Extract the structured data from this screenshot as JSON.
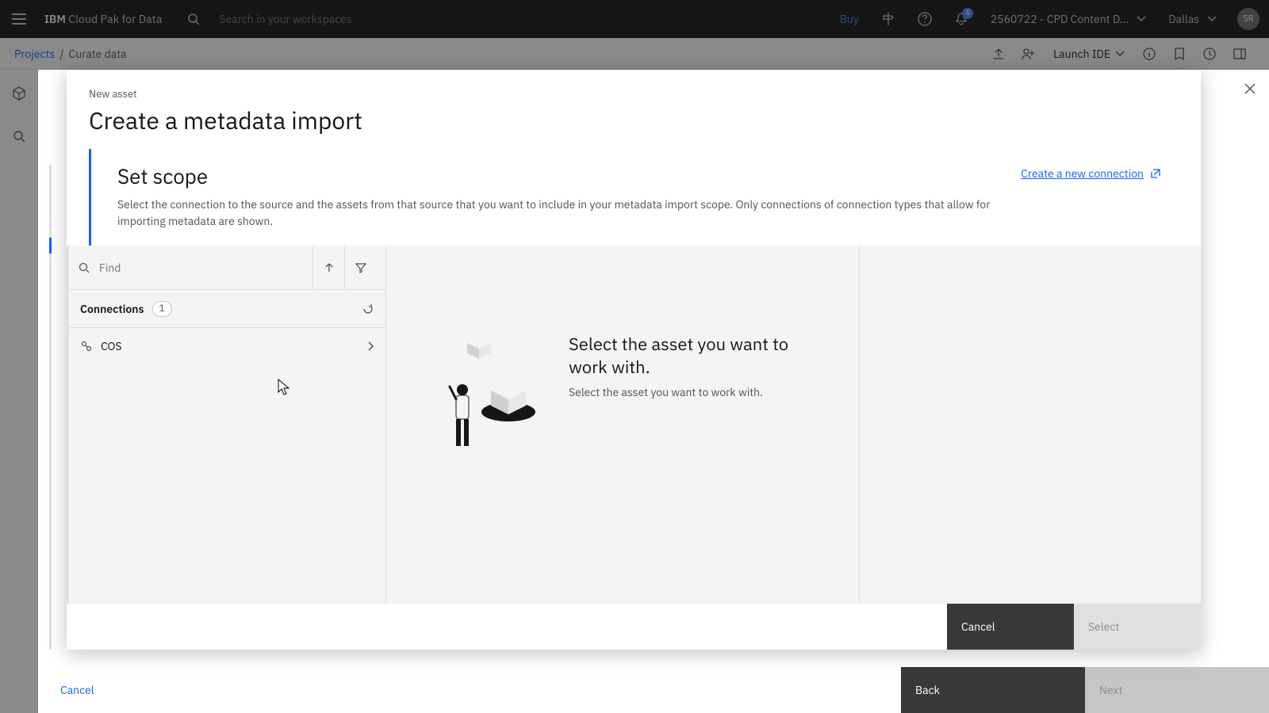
{
  "header": {
    "brand_prefix": "IBM ",
    "brand_product": "Cloud Pak for Data",
    "search_placeholder": "Search in your workspaces",
    "buy": "Buy",
    "account": "2560722 - CPD Content D...",
    "region": "Dallas",
    "avatar_initials": "SR",
    "notif_count": "4"
  },
  "breadcrumb": {
    "root": "Projects",
    "current": "Curate data",
    "launch_ide": "Launch IDE"
  },
  "outer": {
    "cancel": "Cancel",
    "back": "Back",
    "next": "Next"
  },
  "modal": {
    "eyebrow": "New asset",
    "wizard_title": "Create a metadata import",
    "scope_title": "Set scope",
    "scope_desc": "Select the connection to the source and the assets from that source that you want to include in your metadata import scope. Only connections of connection types that allow for importing metadata are shown.",
    "new_connection": "Create a new connection",
    "find_placeholder": "Find",
    "connections_label": "Connections",
    "connections_count": "1",
    "connection_items": [
      {
        "name": "COS"
      }
    ],
    "empty_title": "Select the asset you want to work with.",
    "empty_sub": "Select the asset you want to work with.",
    "cancel": "Cancel",
    "select": "Select"
  }
}
